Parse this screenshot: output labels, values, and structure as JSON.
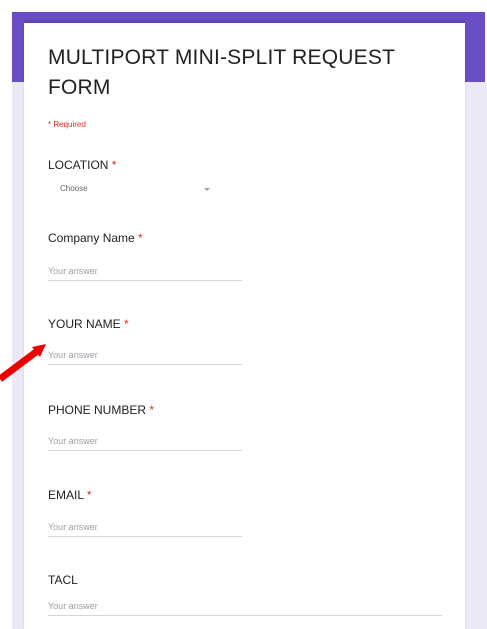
{
  "form": {
    "title": "MULTIPORT MINI-SPLIT REQUEST FORM",
    "required_note": "* Required",
    "required_marker": "*"
  },
  "questions": {
    "location": {
      "label": "LOCATION",
      "selected": "Choose"
    },
    "company_name": {
      "label": "Company Name",
      "placeholder": "Your answer"
    },
    "your_name": {
      "label": "YOUR NAME",
      "placeholder": "Your answer"
    },
    "phone_number": {
      "label": "PHONE NUMBER",
      "placeholder": "Your answer"
    },
    "email": {
      "label": "EMAIL",
      "placeholder": "Your answer"
    },
    "tacl": {
      "label": "TACL",
      "placeholder": "Your answer"
    }
  },
  "colors": {
    "accent": "#6a4fc4",
    "required": "#d93025",
    "annotation_arrow": "#ee0000"
  }
}
